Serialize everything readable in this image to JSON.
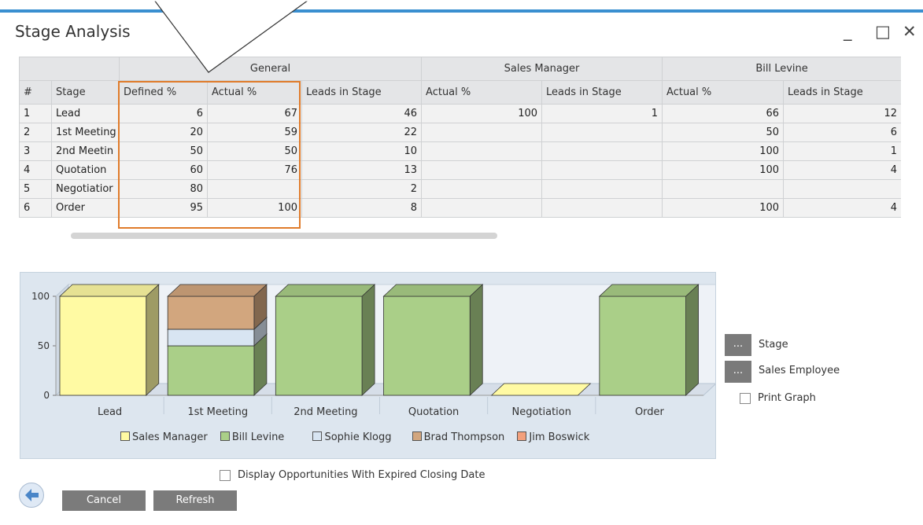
{
  "window": {
    "title": "Stage Analysis",
    "minimize": "_",
    "maximize": "□",
    "close": "✕"
  },
  "grid": {
    "groups": [
      "General",
      "Sales Manager",
      "Bill Levine"
    ],
    "columns": [
      "#",
      "Stage",
      "Defined %",
      "Actual %",
      "Leads in Stage",
      "Actual %",
      "Leads in Stage",
      "Actual %",
      "Leads in Stage"
    ],
    "rows": [
      [
        "1",
        "Lead",
        "6",
        "67",
        "46",
        "100",
        "1",
        "66",
        "12"
      ],
      [
        "2",
        "1st Meeting",
        "20",
        "59",
        "22",
        "",
        "",
        "50",
        "6"
      ],
      [
        "3",
        "2nd Meetin",
        "50",
        "50",
        "10",
        "",
        "",
        "100",
        "1"
      ],
      [
        "4",
        "Quotation",
        "60",
        "76",
        "13",
        "",
        "",
        "100",
        "4"
      ],
      [
        "5",
        "Negotiatior",
        "80",
        "",
        "2",
        "",
        "",
        "",
        ""
      ],
      [
        "6",
        "Order",
        "95",
        "100",
        "8",
        "",
        "",
        "100",
        "4"
      ]
    ]
  },
  "chart_data": {
    "type": "bar",
    "categories": [
      "Lead",
      "1st Meeting",
      "2nd Meeting",
      "Quotation",
      "Negotiation",
      "Order"
    ],
    "yticks": [
      "100",
      "50",
      "0"
    ],
    "ylim": [
      0,
      100
    ],
    "series": [
      {
        "name": "Sales Manager",
        "color": "#fffaa3",
        "values": [
          100,
          0,
          0,
          0,
          0,
          0
        ]
      },
      {
        "name": "Bill Levine",
        "color": "#aacf88",
        "values": [
          0,
          50,
          100,
          100,
          0,
          100
        ]
      },
      {
        "name": "Sophie Klogg",
        "color": "#d8e5f2",
        "values": [
          0,
          16.7,
          0,
          0,
          0,
          0
        ]
      },
      {
        "name": "Brad Thompson",
        "color": "#d2a67e",
        "values": [
          0,
          33.3,
          0,
          0,
          0,
          0
        ]
      },
      {
        "name": "Jim Boswick",
        "color": "#f3a07c",
        "values": [
          0,
          0,
          0,
          0,
          0,
          0
        ]
      }
    ],
    "legend_position": "bottom"
  },
  "side": {
    "stage_btn": "...",
    "stage_label": "Stage",
    "employee_btn": "...",
    "employee_label": "Sales Employee",
    "print_label": "Print Graph"
  },
  "footer": {
    "expired_label": "Display Opportunities With Expired Closing Date",
    "cancel": "Cancel",
    "refresh": "Refresh"
  }
}
